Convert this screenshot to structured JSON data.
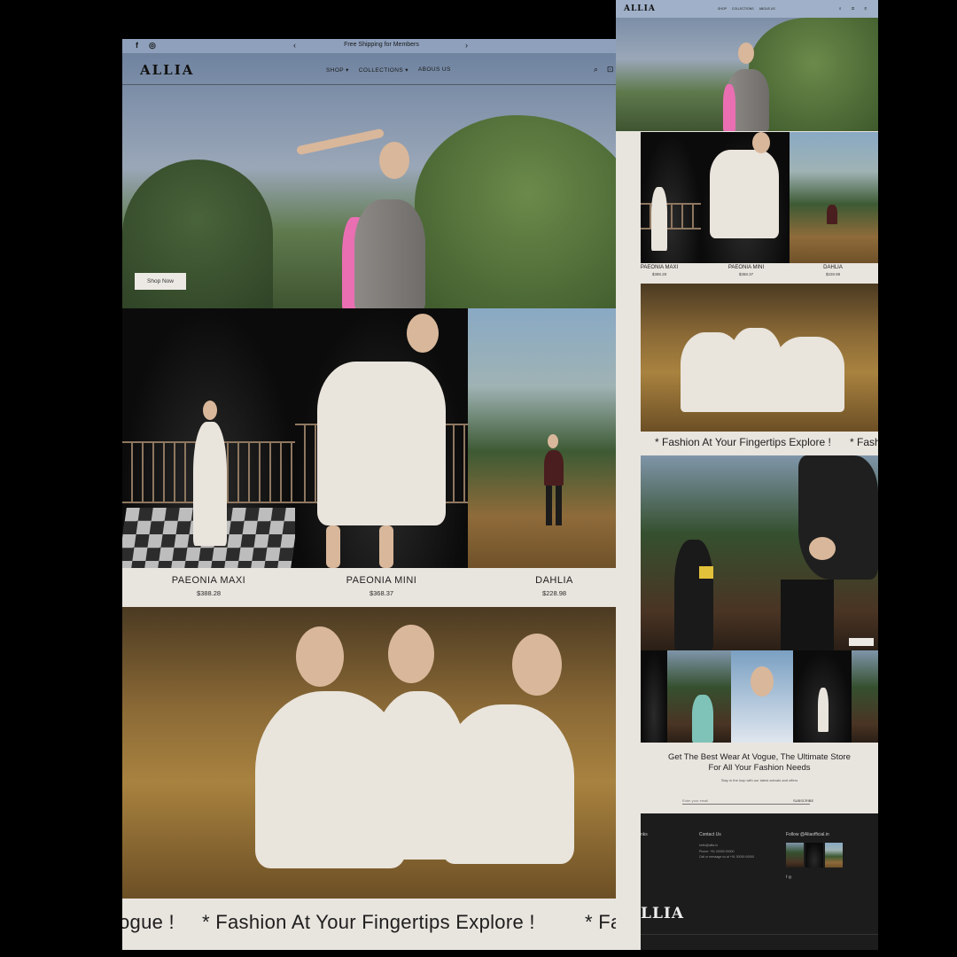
{
  "main": {
    "announcement": {
      "text": "Free Shipping for Members",
      "prev": "‹",
      "next": "›"
    },
    "social": {
      "facebook": "f",
      "instagram": "◎"
    },
    "logo": "ALLIA",
    "menu": [
      "SHOP ▾",
      "COLLECTIONS ▾",
      "ABOUS US"
    ],
    "icons": {
      "search": "⌕",
      "cart": "⊡",
      "account": "⚲"
    },
    "hero": {
      "cta": "Shop Now"
    },
    "products": [
      {
        "name": "PAEONIA MAXI",
        "price": "$388.28"
      },
      {
        "name": "PAEONIA MINI",
        "price": "$368.37"
      },
      {
        "name": "DAHLIA",
        "price": "$228.98"
      }
    ],
    "marquee": [
      "ogue !",
      "* Fashion At Your Fingertips Explore !",
      "* Fash"
    ]
  },
  "side": {
    "logo": "ALLIA",
    "menu": [
      "SHOP",
      "COLLECTIONS",
      "ABOUS US"
    ],
    "icons": "⌕ ⊡ ⚲",
    "products": [
      {
        "name": "PAEONIA MAXI",
        "price": "$388.28"
      },
      {
        "name": "PAEONIA MINI",
        "price": "$368.37"
      },
      {
        "name": "DAHLIA",
        "price": "$228.98"
      }
    ],
    "marquee": [
      "* Fashion At Your Fingertips Explore !",
      "* Fash"
    ],
    "newsletter": {
      "title": "Get The Best Wear At Vogue, The Ultimate Store For All Your Fashion Needs",
      "sub": "Stay in the loop with our latest arrivals and offers",
      "placeholder": "Enter your email",
      "button": "SUBSCRIBE"
    },
    "footer": {
      "links_title": "nks",
      "contact_title": "Contact Us",
      "follow_title": "Follow @Aliaofficial.in",
      "contact_lines": [
        "hello@allia.in",
        "Phone: +91 00000 00000",
        "Call or message us at +91 00000 00000"
      ],
      "logo": "LLIA",
      "social": "f ◎"
    }
  }
}
